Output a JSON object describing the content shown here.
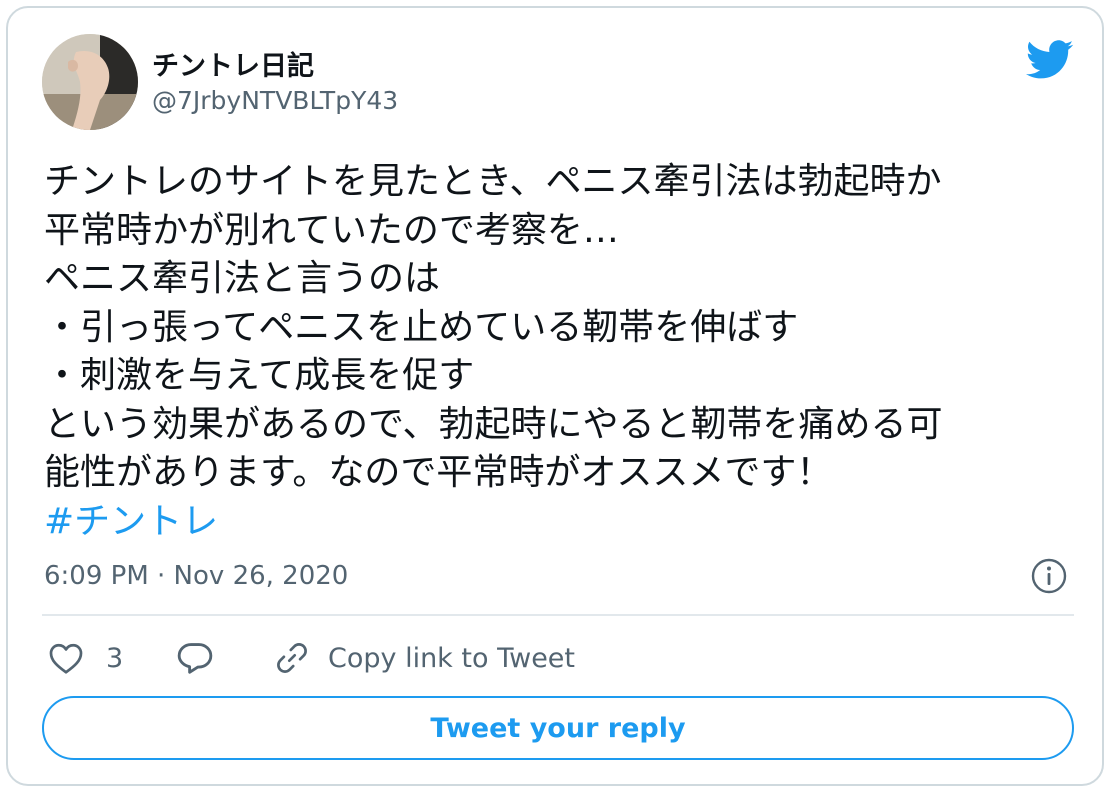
{
  "author": {
    "display_name": "チントレ日記",
    "handle": "@7JrbyNTVBLTpY43"
  },
  "tweet": {
    "lines": [
      "チントレのサイトを見たとき、ペニス牽引法は勃起時か",
      "平常時かが別れていたので考察を…",
      "ペニス牽引法と言うのは",
      "・引っ張ってペニスを止めている靭帯を伸ばす",
      "・刺激を与えて成長を促す",
      "という効果があるので、勃起時にやると靭帯を痛める可",
      "能性があります。なので平常時がオススメです！"
    ],
    "hashtag": "#チントレ",
    "timestamp": "6:09 PM · Nov 26, 2020"
  },
  "actions": {
    "like_count": "3",
    "copy_link_label": "Copy link to Tweet",
    "reply_button_label": "Tweet your reply"
  },
  "colors": {
    "accent": "#1d9bf0",
    "secondary_text": "#536471",
    "border": "#cfd9de"
  },
  "icons": {
    "brand": "twitter-bird-icon",
    "info": "info-icon",
    "like": "heart-icon",
    "reply": "reply-bubble-icon",
    "copy": "link-icon"
  }
}
